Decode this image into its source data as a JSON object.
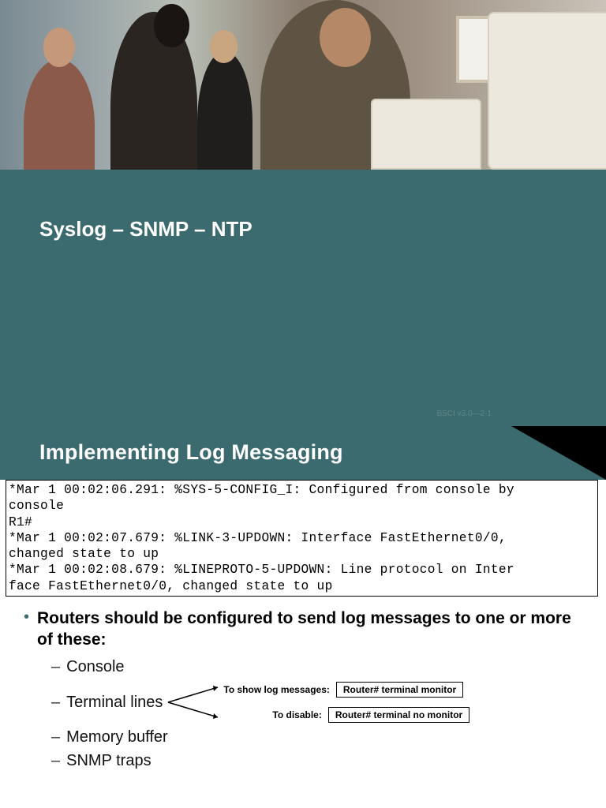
{
  "hero": {
    "alt": "Photo of people at computers in a classroom"
  },
  "titleBand": {
    "title": "Syslog – SNMP – NTP",
    "footer": "BSCI v3.0—2-1"
  },
  "subBand": {
    "title": "Implementing Log Messaging"
  },
  "logBox": {
    "line1": "*Mar  1 00:02:06.291: %SYS-5-CONFIG_I: Configured from console by",
    "line2": " console",
    "line3": "R1#",
    "line4": "*Mar  1 00:02:07.679: %LINK-3-UPDOWN: Interface FastEthernet0/0,",
    "line5": "changed state to up",
    "line6": "*Mar  1 00:02:08.679: %LINEPROTO-5-UPDOWN: Line protocol on Inter",
    "line7": "face FastEthernet0/0, changed state to up"
  },
  "content": {
    "mainBullet": "Routers should be configured to send log messages to one or more of these:",
    "items": {
      "console": "Console",
      "terminal": "Terminal lines",
      "memory": "Memory buffer",
      "snmp": "SNMP traps"
    },
    "terminalCommands": {
      "showLabel": "To show log messages:",
      "showCmd": "Router# terminal monitor",
      "disableLabel": "To disable:",
      "disableCmd": "Router# terminal no monitor"
    }
  }
}
